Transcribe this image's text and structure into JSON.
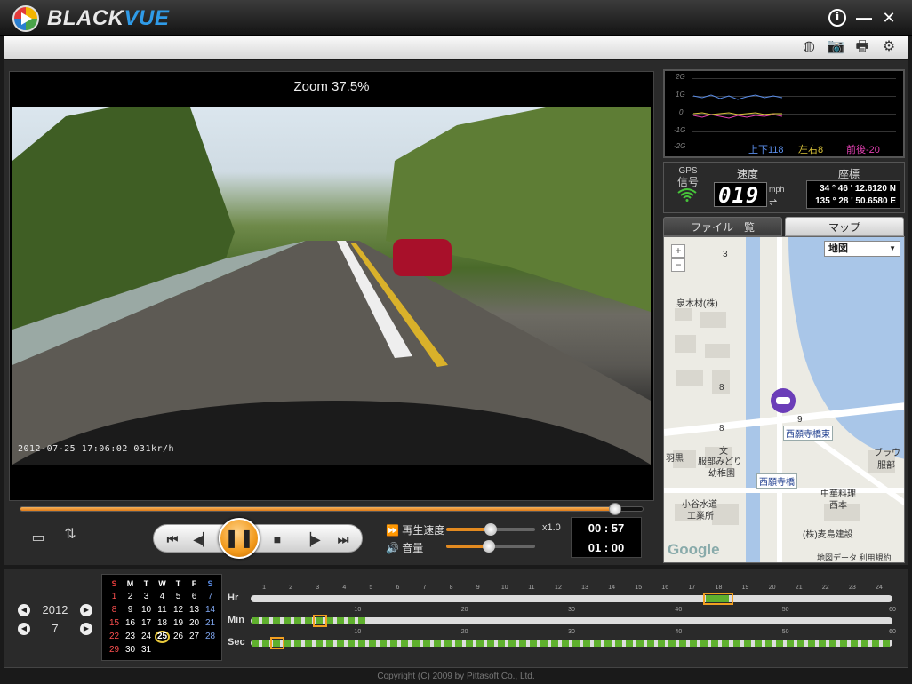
{
  "app": {
    "title_left": "BLACK",
    "title_right": "VUE",
    "info_glyph": "i",
    "minimize_glyph": "—",
    "close_glyph": "✕"
  },
  "toolbar": {
    "icons": [
      "globe-icon",
      "camera-icon",
      "printer-icon",
      "gear-icon"
    ],
    "glyphs": [
      "◍",
      "📷",
      "🖶",
      "⚙"
    ]
  },
  "video": {
    "zoom_label": "Zoom 37.5%",
    "osd": "2012-07-25  17:06:02   031kr/h",
    "progress": 0.955
  },
  "playback": {
    "speed_label": "再生速度",
    "speed_value": "x1.0",
    "speed_level": 0.5,
    "volume_label": "音量",
    "volume_level": 0.48,
    "time_current": "00 : 57",
    "time_total": "01 : 00",
    "glyphs": {
      "first": "⏮",
      "prev_frame": "◀▏",
      "pause": "❚❚",
      "stop": "■",
      "next_frame": "▕▶",
      "last": "⏭",
      "fast_forward": "⏩",
      "volume": "🔊"
    }
  },
  "gsensor": {
    "ticks": [
      "2G",
      "1G",
      "0",
      "-1G",
      "-2G"
    ],
    "updown": "上下118",
    "leftright": "左右8",
    "frontback": "前後-20",
    "colors": {
      "updown": "#5a8de8",
      "leftright": "#d9c33a",
      "frontback": "#e040b0"
    }
  },
  "gps": {
    "signal_label_1": "GPS",
    "signal_label_2": "信号",
    "speed_label": "速度",
    "speed_value": "019",
    "speed_unit": "mph",
    "speed_toggle": "⇌",
    "coord_label": "座標",
    "lat": "34 ° 46 ' 12.6120 N",
    "lon": "135 ° 28 ' 50.6580 E"
  },
  "tabs": {
    "file_list": "ファイル一覧",
    "map": "マップ"
  },
  "map": {
    "type_select": "地図",
    "zoom_in": "+",
    "zoom_out": "−",
    "labels": {
      "izumikizai": "泉木材(株)",
      "nishiganji_east": "西願寺橋東",
      "nishiganji": "西願寺橋",
      "midori": "服部みどり",
      "kindergarten": "幼稚園",
      "hanyu": "羽黒",
      "brown": "ブラウ",
      "hattori": "服部",
      "kotani_1": "小谷水道",
      "kotani_2": "工業所",
      "chuka_1": "中華料理",
      "chuka_2": "西本",
      "mugishima": "(株)麦島建設",
      "bun": "文",
      "num3": "3",
      "num8a": "8",
      "num8b": "8",
      "num9": "9",
      "google": "Google",
      "copyright": "地図データ  利用規約"
    }
  },
  "bottom": {
    "year": "2012",
    "month": "7",
    "calendar": {
      "headers": [
        "S",
        "M",
        "T",
        "W",
        "T",
        "F",
        "S"
      ],
      "weeks": [
        [
          "1",
          "2",
          "3",
          "4",
          "5",
          "6",
          "7"
        ],
        [
          "8",
          "9",
          "10",
          "11",
          "12",
          "13",
          "14"
        ],
        [
          "15",
          "16",
          "17",
          "18",
          "19",
          "20",
          "21"
        ],
        [
          "22",
          "23",
          "24",
          "25",
          "26",
          "27",
          "28"
        ],
        [
          "29",
          "30",
          "31",
          "",
          "",
          "",
          ""
        ]
      ],
      "selected": "25"
    },
    "hr_label": "Hr",
    "min_label": "Min",
    "sec_label": "Sec",
    "hr_ticks": [
      "1",
      "2",
      "3",
      "4",
      "5",
      "6",
      "7",
      "8",
      "9",
      "10",
      "11",
      "12",
      "13",
      "14",
      "15",
      "16",
      "17",
      "18",
      "19",
      "20",
      "21",
      "22",
      "23",
      "24"
    ],
    "min_ticks": [
      "10",
      "20",
      "30",
      "40",
      "50",
      "60"
    ],
    "sec_ticks": [
      "10",
      "20",
      "30",
      "40",
      "50",
      "60"
    ],
    "hr_selected": 17,
    "min_selected": 6,
    "sec_selected": 2
  },
  "copyright": "Copyright (C) 2009 by Pittasoft Co., Ltd."
}
